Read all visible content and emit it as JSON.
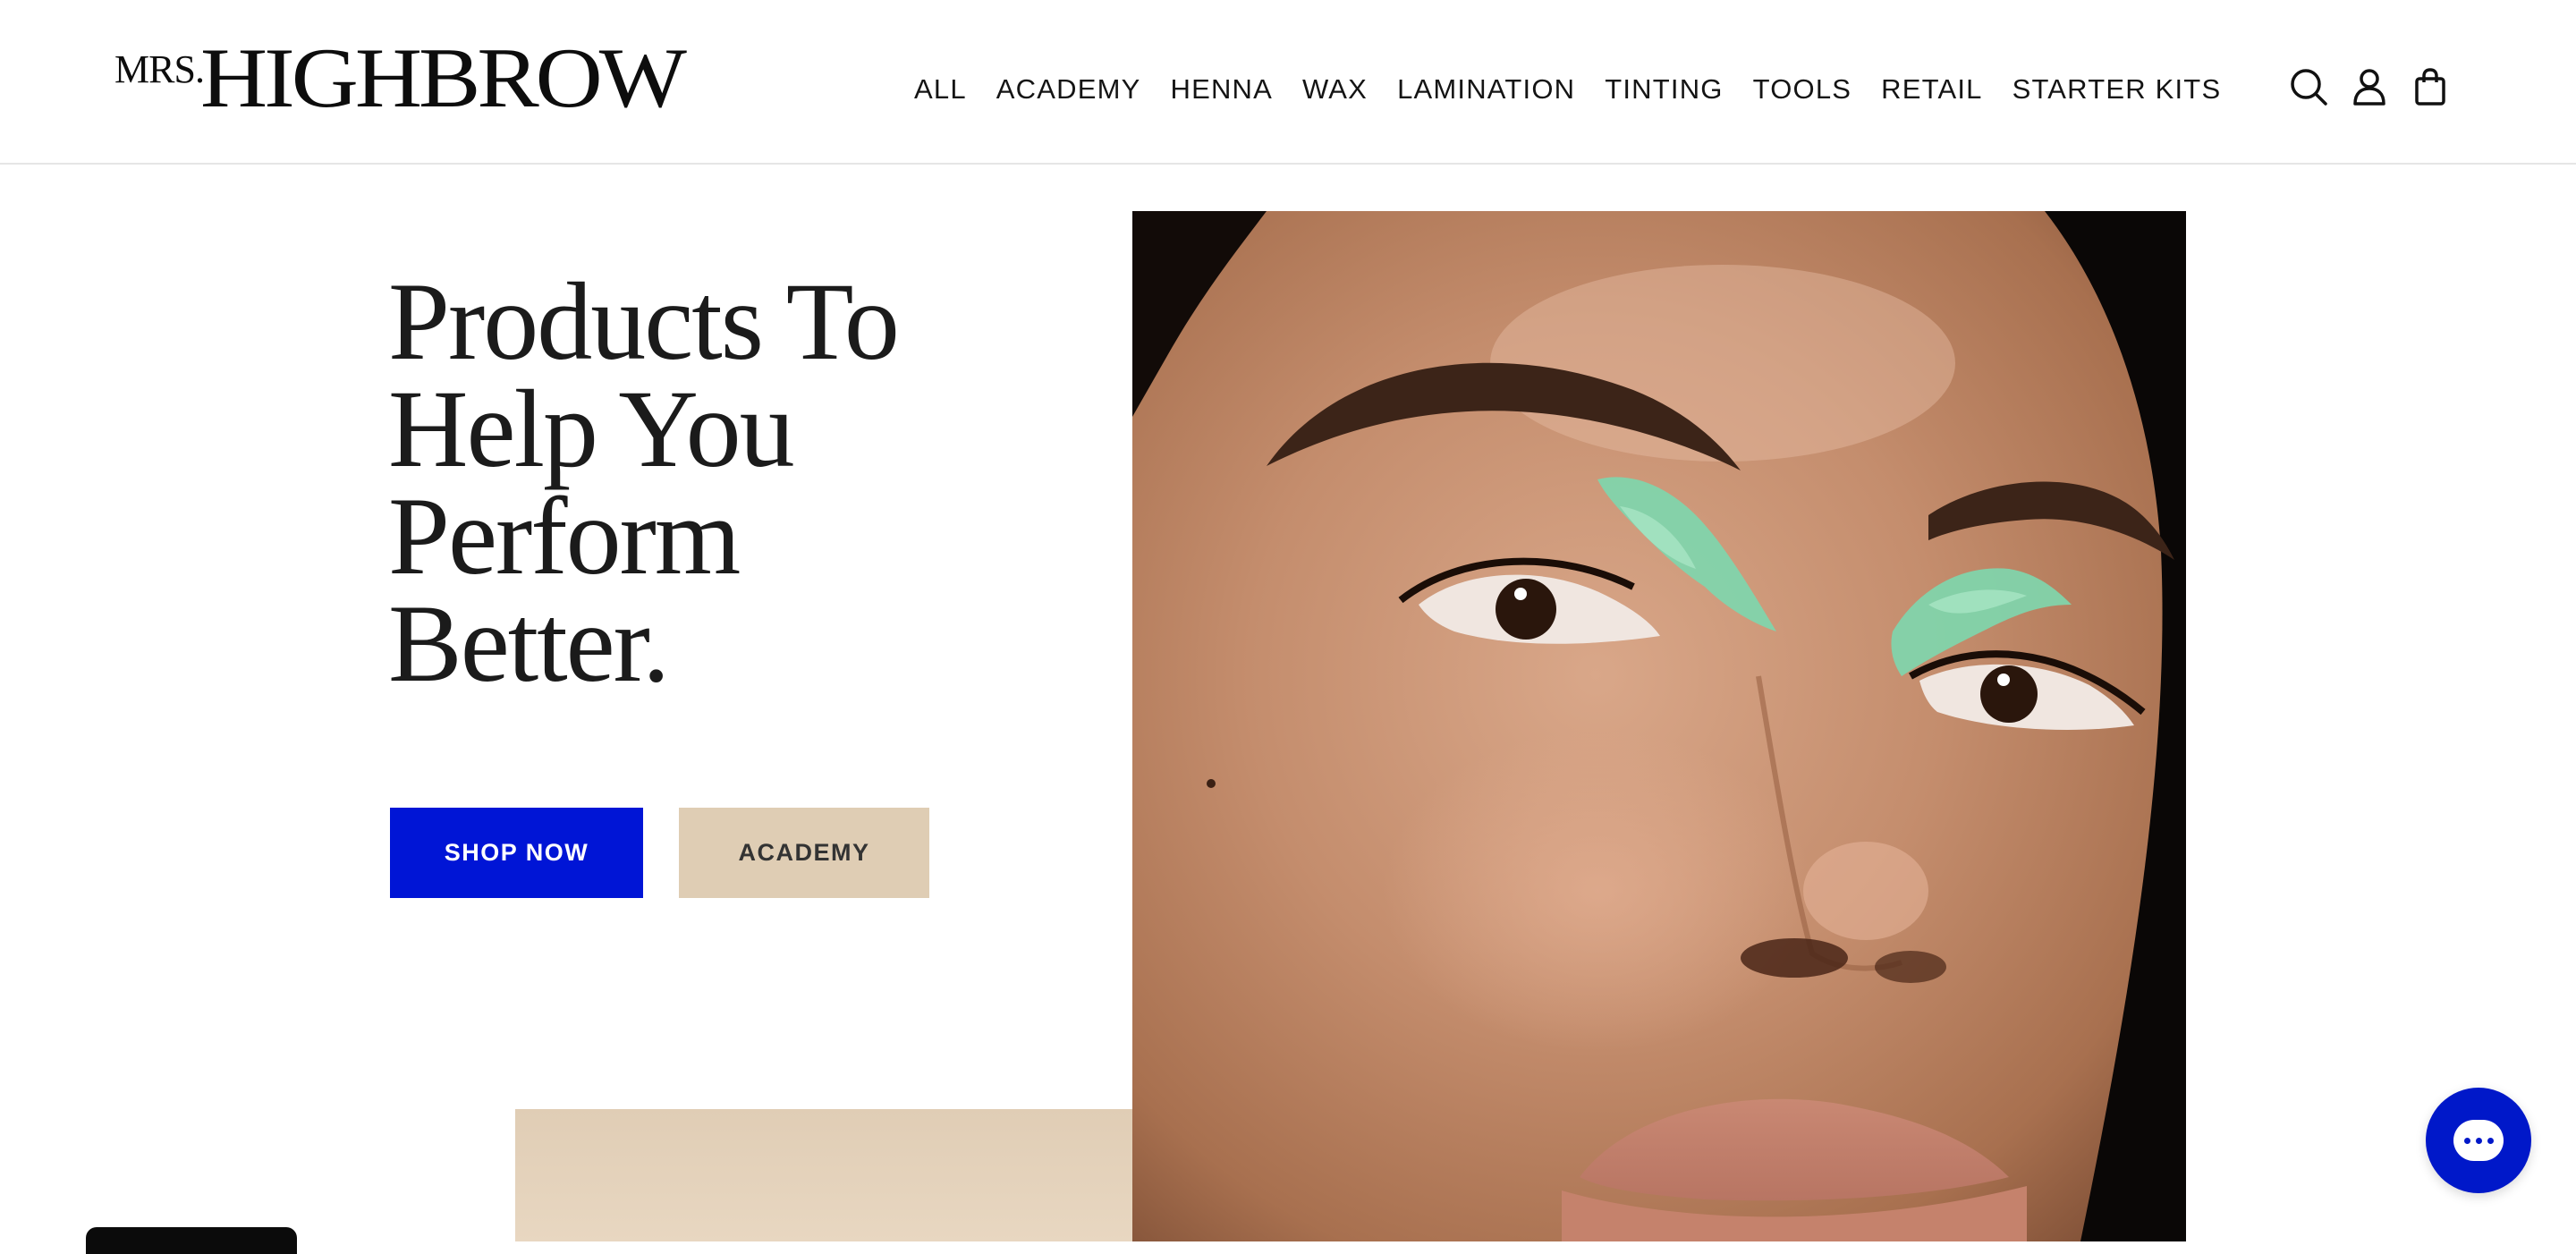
{
  "brand": {
    "logo_prefix": "MRS.",
    "logo_main": "HIGHBROW"
  },
  "nav": {
    "items": [
      {
        "label": "ALL"
      },
      {
        "label": "ACADEMY"
      },
      {
        "label": "HENNA"
      },
      {
        "label": "WAX"
      },
      {
        "label": "LAMINATION"
      },
      {
        "label": "TINTING"
      },
      {
        "label": "TOOLS"
      },
      {
        "label": "RETAIL"
      },
      {
        "label": "STARTER KITS"
      }
    ]
  },
  "header_icons": [
    "search-icon",
    "account-icon",
    "cart-icon"
  ],
  "hero": {
    "title_lines": [
      "Products To",
      "Help You",
      "Perform",
      "Better."
    ],
    "primary_button": "SHOP NOW",
    "secondary_button": "ACADEMY"
  },
  "colors": {
    "primary_blue": "#0015d6",
    "beige": "#dfcdb4",
    "text": "#141414"
  }
}
